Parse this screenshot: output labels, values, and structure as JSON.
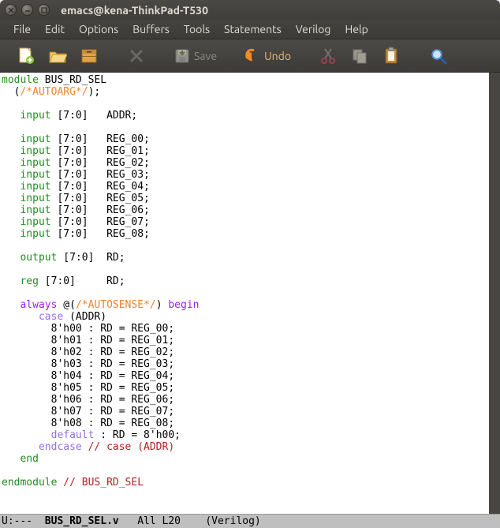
{
  "window": {
    "title": "emacs@kena-ThinkPad-T530"
  },
  "menu": [
    "File",
    "Edit",
    "Options",
    "Buffers",
    "Tools",
    "Statements",
    "Verilog",
    "Help"
  ],
  "toolbar": {
    "save_label": "Save",
    "undo_label": "Undo"
  },
  "code": {
    "module_kw": "module",
    "module_name": "BUS_RD_SEL",
    "autoarg": "/*AUTOARG*/",
    "input_kw": "input",
    "output_kw": "output",
    "reg_kw": "reg",
    "always_kw": "always",
    "begin_kw": "begin",
    "case_kw": "case",
    "endcase_kw": "endcase",
    "end_kw": "end",
    "default_kw": "default",
    "endmodule_kw": "endmodule",
    "autosense": "/*AUTOSENSE*/",
    "range": "[7:0]",
    "signals": {
      "addr": "ADDR",
      "rd": "RD",
      "regs": [
        "REG_00",
        "REG_01",
        "REG_02",
        "REG_03",
        "REG_04",
        "REG_05",
        "REG_06",
        "REG_07",
        "REG_08"
      ]
    },
    "cases": [
      {
        "cond": "8'h00",
        "rhs": "REG_00"
      },
      {
        "cond": "8'h01",
        "rhs": "REG_01"
      },
      {
        "cond": "8'h02",
        "rhs": "REG_02"
      },
      {
        "cond": "8'h03",
        "rhs": "REG_03"
      },
      {
        "cond": "8'h04",
        "rhs": "REG_04"
      },
      {
        "cond": "8'h05",
        "rhs": "REG_05"
      },
      {
        "cond": "8'h06",
        "rhs": "REG_06"
      },
      {
        "cond": "8'h07",
        "rhs": "REG_07"
      },
      {
        "cond": "8'h08",
        "rhs": "REG_08"
      }
    ],
    "default_rhs": "8'h00",
    "endcase_comment": "// case (ADDR)",
    "endmodule_comment": "// BUS_RD_SEL"
  },
  "modeline": {
    "left": "U:---",
    "file": "BUS_RD_SEL.v",
    "pos": "All L20",
    "mode": "(Verilog)"
  }
}
